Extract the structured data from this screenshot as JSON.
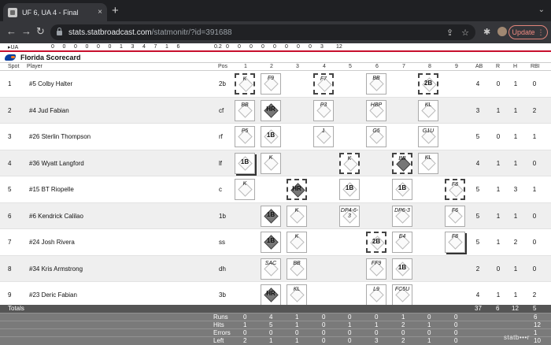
{
  "browser": {
    "tab_title": "UF 6, UA 4 - Final",
    "tab_close": "×",
    "new_tab": "+",
    "url_host": "stats.statbroadcast.com",
    "url_path": "/statmonitr/?id=391688",
    "update_label": "Update",
    "update_menu": "⋮",
    "back": "←",
    "forward": "→",
    "reload": "↻",
    "share": "⇪",
    "star": "☆",
    "extensions": "✱",
    "tab_search": "⌄"
  },
  "ua_line": {
    "team": "▸UA",
    "innings": [
      "0",
      "0",
      "0",
      "0",
      "0",
      "0",
      "1",
      "3",
      "4",
      "7",
      "1",
      "6"
    ],
    "tail": [
      "0.2",
      "0",
      "0",
      "0",
      "0",
      "0",
      "0",
      "0",
      "0",
      "3",
      "12"
    ]
  },
  "scorecard": {
    "title": "Florida Scorecard",
    "headers": {
      "spot": "Spot",
      "player": "Player",
      "pos": "Pos",
      "ab": "AB",
      "r": "R",
      "h": "H",
      "rbi": "RBI"
    },
    "innings": [
      "1",
      "2",
      "3",
      "4",
      "5",
      "6",
      "7",
      "8",
      "9"
    ],
    "players": [
      {
        "spot": "1",
        "name": "#5 Colby Halter",
        "pos": "2b",
        "ab": "4",
        "r": "0",
        "h": "1",
        "rbi": "0",
        "plays": [
          {
            "inn": 0,
            "txt": "K",
            "dash": true
          },
          {
            "inn": 1,
            "txt": "F9"
          },
          {
            "inn": 3,
            "txt": "F7",
            "dash": true
          },
          {
            "inn": 5,
            "txt": "BB"
          },
          {
            "inn": 7,
            "txt": "2B",
            "big": true,
            "dash": true
          }
        ]
      },
      {
        "spot": "2",
        "name": "#4 Jud Fabian",
        "pos": "cf",
        "ab": "3",
        "r": "1",
        "h": "1",
        "rbi": "2",
        "plays": [
          {
            "inn": 0,
            "txt": "BB"
          },
          {
            "inn": 1,
            "txt": "HR",
            "big": true,
            "dark": true
          },
          {
            "inn": 3,
            "txt": "P3"
          },
          {
            "inn": 5,
            "txt": "HBP"
          },
          {
            "inn": 7,
            "txt": "KL"
          }
        ]
      },
      {
        "spot": "3",
        "name": "#26 Sterlin Thompson",
        "pos": "rf",
        "ab": "5",
        "r": "0",
        "h": "1",
        "rbi": "1",
        "plays": [
          {
            "inn": 0,
            "txt": "P5"
          },
          {
            "inn": 1,
            "txt": "1B",
            "big": true
          },
          {
            "inn": 3,
            "txt": "1"
          },
          {
            "inn": 5,
            "txt": "G5"
          },
          {
            "inn": 7,
            "txt": "G1U"
          }
        ]
      },
      {
        "spot": "4",
        "name": "#36 Wyatt Langford",
        "pos": "lf",
        "ab": "4",
        "r": "1",
        "h": "1",
        "rbi": "0",
        "plays": [
          {
            "inn": 0,
            "txt": "1B",
            "big": true,
            "thick": true
          },
          {
            "inn": 1,
            "txt": "K"
          },
          {
            "inn": 4,
            "txt": "K",
            "dash": true
          },
          {
            "inn": 6,
            "txt": "BB",
            "dark": true,
            "dash": true
          },
          {
            "inn": 7,
            "txt": "KL"
          }
        ]
      },
      {
        "spot": "5",
        "name": "#15 BT Riopelle",
        "pos": "c",
        "ab": "5",
        "r": "1",
        "h": "3",
        "rbi": "1",
        "plays": [
          {
            "inn": 0,
            "txt": "K"
          },
          {
            "inn": 2,
            "txt": "HR",
            "big": true,
            "dark": true,
            "dash": true
          },
          {
            "inn": 4,
            "txt": "1B",
            "big": true
          },
          {
            "inn": 6,
            "txt": "1B",
            "big": true
          },
          {
            "inn": 8,
            "txt": "F8",
            "dash": true
          }
        ]
      },
      {
        "spot": "6",
        "name": "#6 Kendrick Calilao",
        "pos": "1b",
        "ab": "5",
        "r": "1",
        "h": "1",
        "rbi": "0",
        "plays": [
          {
            "inn": 1,
            "txt": "1B",
            "big": true,
            "dark": true
          },
          {
            "inn": 2,
            "txt": "K"
          },
          {
            "inn": 4,
            "txt": "DP4-6-3"
          },
          {
            "inn": 6,
            "txt": "DP6-3"
          },
          {
            "inn": 8,
            "txt": "F6"
          }
        ]
      },
      {
        "spot": "7",
        "name": "#24 Josh Rivera",
        "pos": "ss",
        "ab": "5",
        "r": "1",
        "h": "2",
        "rbi": "0",
        "plays": [
          {
            "inn": 1,
            "txt": "1B",
            "big": true,
            "dark": true
          },
          {
            "inn": 2,
            "txt": "K"
          },
          {
            "inn": 5,
            "txt": "2B",
            "big": true,
            "dash": true
          },
          {
            "inn": 6,
            "txt": "E4"
          },
          {
            "inn": 8,
            "txt": "F8",
            "thick": true
          }
        ]
      },
      {
        "spot": "8",
        "name": "#34 Kris Armstrong",
        "pos": "dh",
        "ab": "2",
        "r": "0",
        "h": "1",
        "rbi": "0",
        "plays": [
          {
            "inn": 1,
            "txt": "SAC"
          },
          {
            "inn": 2,
            "txt": "BB"
          },
          {
            "inn": 5,
            "txt": "FF9"
          },
          {
            "inn": 6,
            "txt": "1B",
            "big": true
          }
        ]
      },
      {
        "spot": "9",
        "name": "#23 Deric Fabian",
        "pos": "3b",
        "ab": "4",
        "r": "1",
        "h": "1",
        "rbi": "2",
        "plays": [
          {
            "inn": 1,
            "txt": "HR",
            "big": true,
            "dark": true
          },
          {
            "inn": 2,
            "txt": "KL"
          },
          {
            "inn": 5,
            "txt": "L9"
          },
          {
            "inn": 6,
            "txt": "FC5U"
          }
        ]
      }
    ],
    "totals": {
      "label": "Totals",
      "ab": "37",
      "r": "6",
      "h": "12",
      "rbi": "5"
    },
    "linescore": [
      {
        "label": "Runs",
        "vals": [
          "0",
          "4",
          "1",
          "0",
          "0",
          "0",
          "1",
          "0",
          "0"
        ],
        "total": "6"
      },
      {
        "label": "Hits",
        "vals": [
          "1",
          "5",
          "1",
          "0",
          "1",
          "1",
          "2",
          "1",
          "0"
        ],
        "total": "12"
      },
      {
        "label": "Errors",
        "vals": [
          "0",
          "0",
          "0",
          "0",
          "0",
          "0",
          "0",
          "0",
          "0"
        ],
        "total": "1"
      },
      {
        "label": "Left",
        "vals": [
          "2",
          "1",
          "1",
          "0",
          "0",
          "3",
          "2",
          "1",
          "0"
        ],
        "total": "10"
      }
    ],
    "watermark": "statb•••r"
  }
}
